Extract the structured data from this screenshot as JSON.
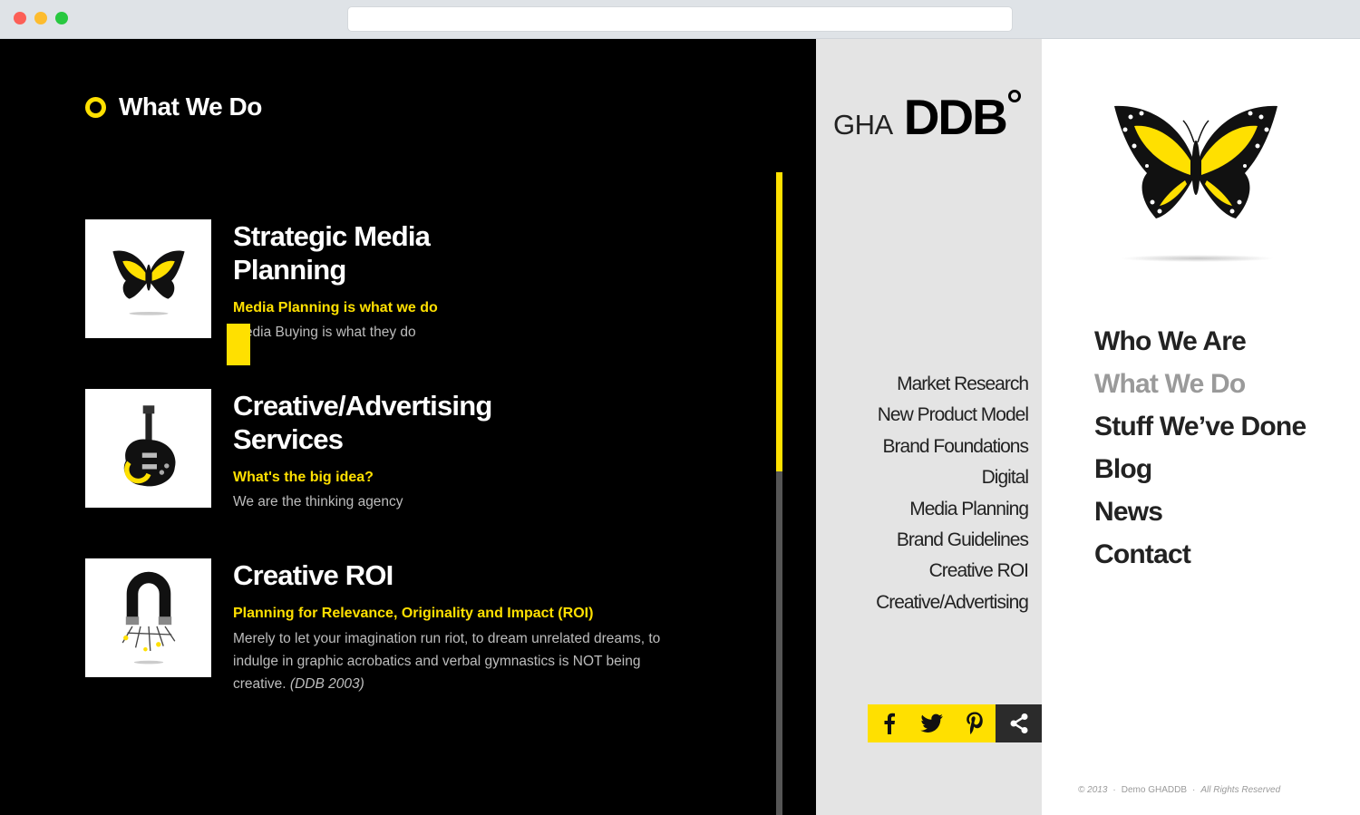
{
  "section": {
    "title": "What We Do"
  },
  "services": [
    {
      "title": "Strategic Media Planning",
      "subtitle": "Media Planning is what we do",
      "description": "Media Buying is what they do",
      "citation": "",
      "icon": "butterfly-icon"
    },
    {
      "title": "Creative/Advertising Services",
      "subtitle": "What's the big idea?",
      "description": "We are the thinking agency",
      "citation": "",
      "icon": "guitar-icon"
    },
    {
      "title": "Creative ROI",
      "subtitle": "Planning for Relevance, Originality and Impact (ROI)",
      "description": "Merely to let your imagination run riot, to dream unrelated dreams, to indulge in graphic acrobatics and verbal gymnastics is NOT being creative.",
      "citation": "(DDB 2003)",
      "icon": "magnet-icon"
    }
  ],
  "logo": {
    "prefix": "GHA",
    "brand": "DDB"
  },
  "sublinks": [
    "Market Research",
    "New Product Model",
    "Brand Foundations",
    "Digital",
    "Media Planning",
    "Brand Guidelines",
    "Creative ROI",
    "Creative/Advertising"
  ],
  "social": [
    "facebook-icon",
    "twitter-icon",
    "pinterest-icon",
    "share-icon"
  ],
  "mainnav": [
    "Who We Are",
    "What We Do",
    "Stuff We’ve Done",
    "Blog",
    "News",
    "Contact"
  ],
  "mainnav_current": "What We Do",
  "footer": {
    "year": "© 2013",
    "site": "Demo GHADDB",
    "rights": "All Rights Reserved"
  },
  "colors": {
    "accent": "#ffe000",
    "background_dark": "#000000",
    "panel_gray": "#e4e4e4"
  }
}
